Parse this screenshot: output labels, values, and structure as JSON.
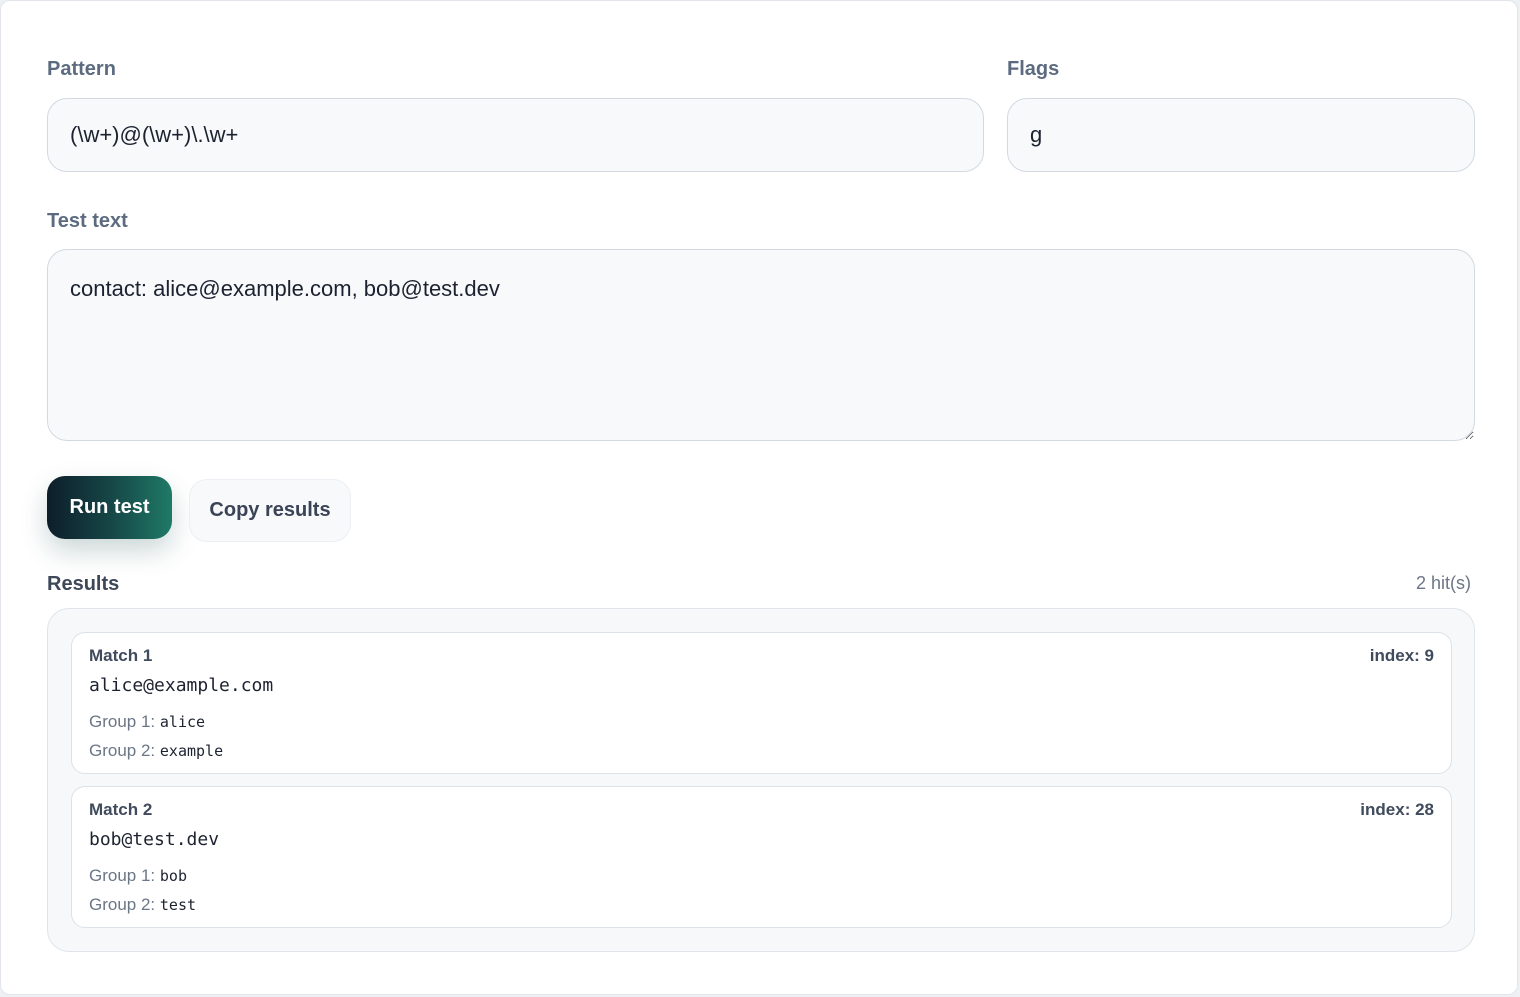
{
  "pattern": {
    "label": "Pattern",
    "value": "(\\w+)@(\\w+)\\.\\w+"
  },
  "flags": {
    "label": "Flags",
    "value": "g"
  },
  "test_text": {
    "label": "Test text",
    "value": "contact: alice@example.com, bob@test.dev"
  },
  "actions": {
    "run_label": "Run test",
    "copy_label": "Copy results"
  },
  "results": {
    "heading": "Results",
    "hits": "2 hit(s)",
    "matches": [
      {
        "title": "Match 1",
        "index": "index: 9",
        "value": "alice@example.com",
        "groups": [
          {
            "label": "Group 1:",
            "value": "alice"
          },
          {
            "label": "Group 2:",
            "value": "example"
          }
        ]
      },
      {
        "title": "Match 2",
        "index": "index: 28",
        "value": "bob@test.dev",
        "groups": [
          {
            "label": "Group 1:",
            "value": "bob"
          },
          {
            "label": "Group 2:",
            "value": "test"
          }
        ]
      }
    ]
  }
}
